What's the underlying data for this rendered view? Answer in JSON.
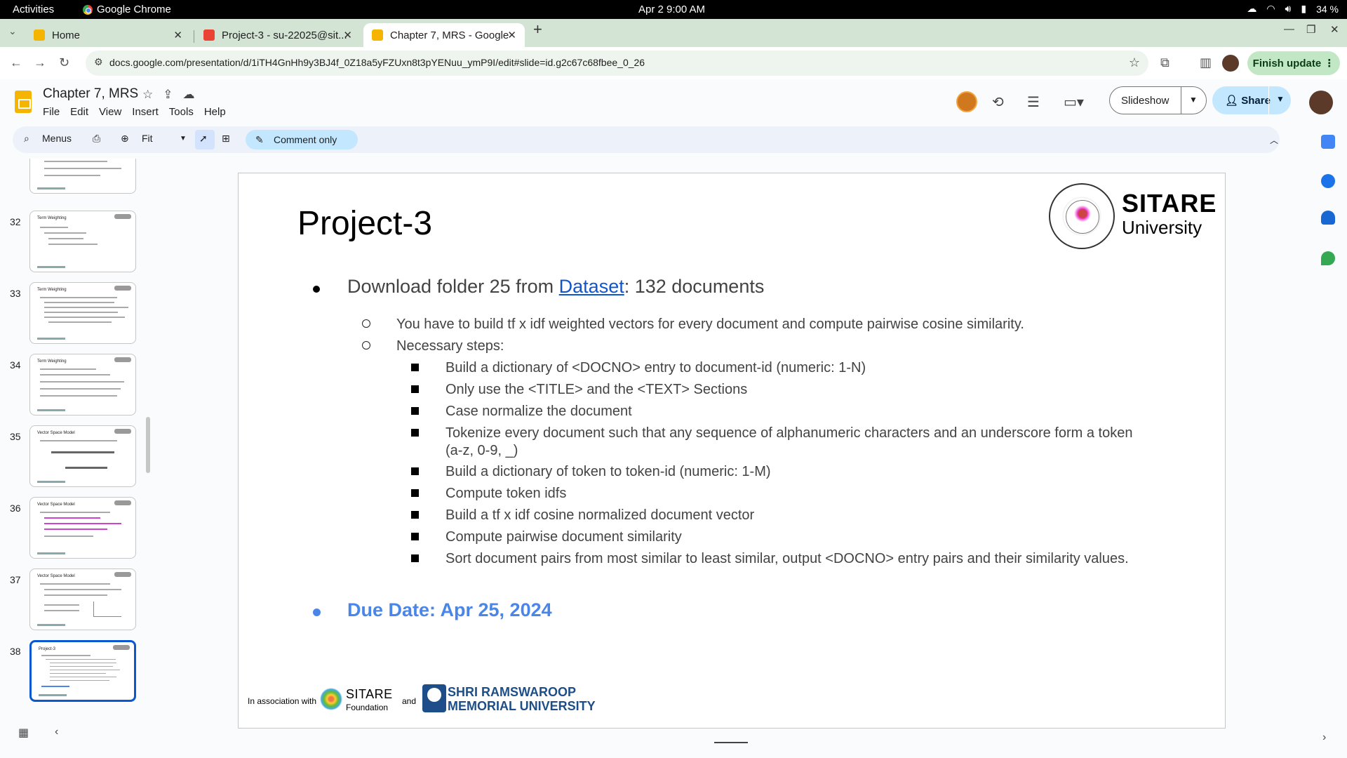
{
  "os": {
    "activities": "Activities",
    "app_name": "Google Chrome",
    "clock": "Apr 2  9:00 AM",
    "battery": "34 %"
  },
  "tabs": [
    {
      "label": "Home",
      "color": "#f4b400"
    },
    {
      "label": "Project-3 - su-22025@sit...",
      "color": "#ea4335"
    },
    {
      "label": "Chapter 7, MRS - Google...",
      "color": "#f4b400"
    }
  ],
  "address": {
    "url": "docs.google.com/presentation/d/1iTH4GnHh9y3BJ4f_0Z18a5yFZUxn8t3pYENuu_ymP9I/edit#slide=id.g2c67c68fbee_0_26"
  },
  "finish_update": "Finish update",
  "doc": {
    "title": "Chapter 7, MRS",
    "menus": [
      "File",
      "Edit",
      "View",
      "Insert",
      "Tools",
      "Help"
    ]
  },
  "buttons": {
    "slideshow": "Slideshow",
    "share": "Share"
  },
  "toolbar": {
    "menus": "Menus",
    "zoom": "Fit",
    "mode": "Comment only"
  },
  "filmstrip": [
    {
      "num": "",
      "title": ""
    },
    {
      "num": "32",
      "title": "Term Weighting"
    },
    {
      "num": "33",
      "title": "Term Weighting"
    },
    {
      "num": "34",
      "title": "Term Weighting"
    },
    {
      "num": "35",
      "title": "Vector Space Model"
    },
    {
      "num": "36",
      "title": "Vector Space Model"
    },
    {
      "num": "37",
      "title": "Vector Space Model"
    },
    {
      "num": "38",
      "title": "Project-3"
    }
  ],
  "slide": {
    "title": "Project-3",
    "brand_name": "SITARE",
    "brand_sub": "University",
    "bullet1_pre": "Download folder 25 from ",
    "bullet1_link": "Dataset",
    "bullet1_post": ": 132 documents",
    "sub1": "You have to build tf x idf weighted vectors for every document and compute pairwise cosine similarity.",
    "sub2": "Necessary steps:",
    "steps": [
      "Build a dictionary of <DOCNO> entry to document-id (numeric: 1-N)",
      "Only use the <TITLE> and the <TEXT> Sections",
      "Case normalize the document",
      "Tokenize every document such that any sequence of alphanumeric characters and an underscore form a token (a-z, 0-9, _)",
      "Build a dictionary of token to token-id (numeric: 1-M)",
      "Compute token idfs",
      "Build a tf x idf cosine normalized document vector",
      "Compute pairwise document similarity",
      "Sort document pairs from most similar to least similar, output <DOCNO> entry pairs and their similarity values."
    ],
    "due": "Due Date: Apr 25, 2024",
    "footer": {
      "assoc": "In association with",
      "sitare_foundation_1": "SITARE",
      "sitare_foundation_2": "Foundation",
      "and": "and",
      "srmu_1": "SHRI RAMSWAROOP",
      "srmu_2": "MEMORIAL UNIVERSITY"
    }
  }
}
